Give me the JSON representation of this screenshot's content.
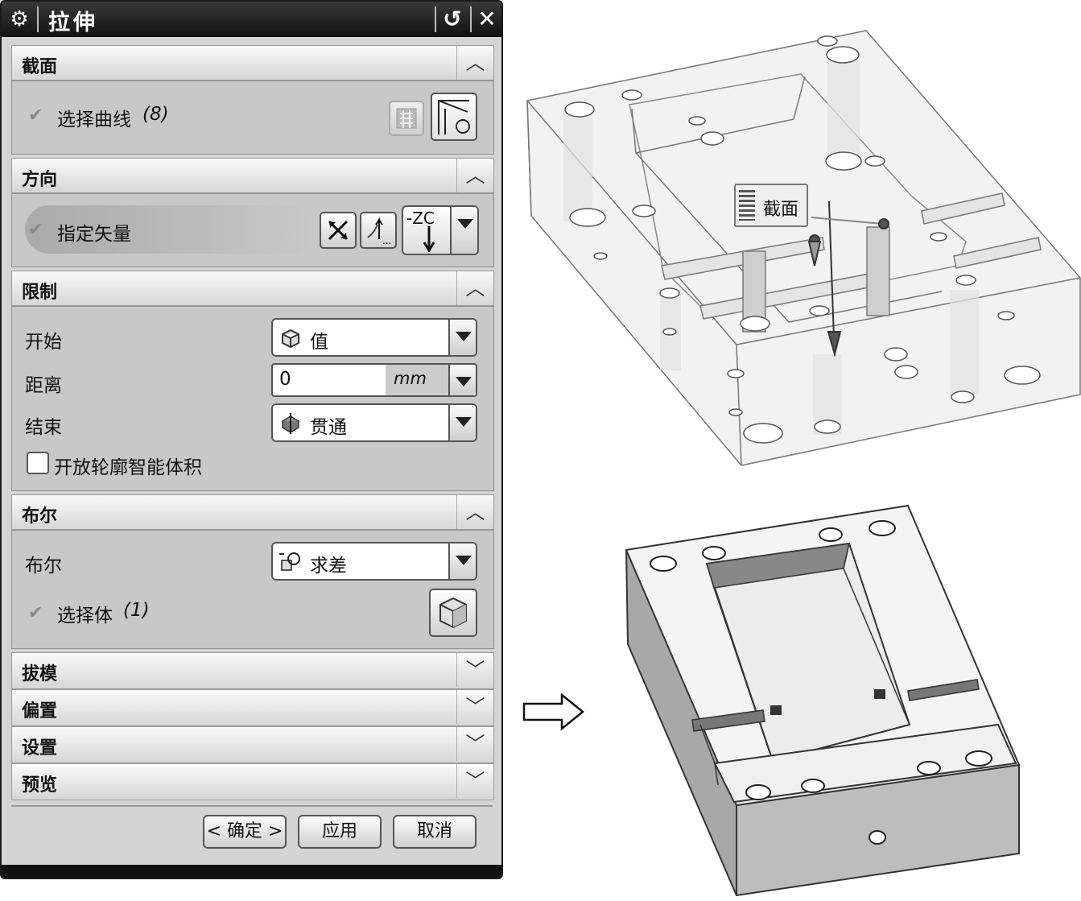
{
  "dialog": {
    "title": "拉伸",
    "sections": {
      "section": {
        "label": "截面",
        "select_curve_label": "选择曲线",
        "select_curve_count": "(8)"
      },
      "direction": {
        "label": "方向",
        "specify_vector_label": "指定矢量",
        "vector_value": "-ZC"
      },
      "limits": {
        "label": "限制",
        "start_label": "开始",
        "start_value": "值",
        "distance_label": "距离",
        "distance_value": "0",
        "distance_unit": "mm",
        "end_label": "结束",
        "end_value": "贯通",
        "open_profile_label": "开放轮廓智能体积"
      },
      "boolean": {
        "label": "布尔",
        "boolean_label": "布尔",
        "boolean_value": "求差",
        "select_body_label": "选择体",
        "select_body_count": "(1)"
      },
      "draft": {
        "label": "拔模"
      },
      "offset": {
        "label": "偏置"
      },
      "settings": {
        "label": "设置"
      },
      "preview": {
        "label": "预览"
      }
    },
    "buttons": {
      "ok": "< 确定 >",
      "apply": "应用",
      "cancel": "取消"
    }
  },
  "viewport": {
    "callout_label": "截面"
  },
  "colors": {
    "title_bar": "#1a1a1a",
    "panel_bg": "#c8c8c8",
    "model_edge": "#555555"
  },
  "icons": [
    "gear-icon",
    "reset-icon",
    "close-icon",
    "chevron-up-icon",
    "chevron-down-icon",
    "checkmark-icon",
    "sketch-section-icon",
    "curve-icon",
    "reverse-direction-icon",
    "vector-dialog-icon",
    "cube-value-icon",
    "through-all-icon",
    "subtract-icon",
    "solid-body-icon",
    "right-arrow-icon"
  ]
}
